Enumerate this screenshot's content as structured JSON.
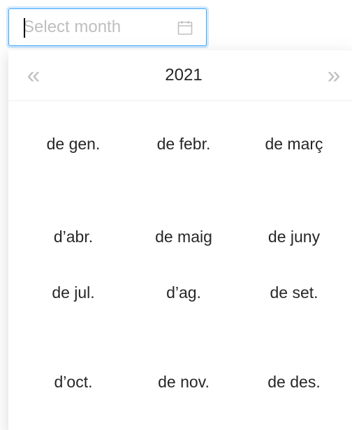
{
  "input": {
    "placeholder": "Select month",
    "value": ""
  },
  "icons": {
    "calendar": "calendar-icon",
    "prev": "double-chevron-left-icon",
    "next": "double-chevron-right-icon"
  },
  "header": {
    "prev_label": "«",
    "year": "2021",
    "next_label": "»"
  },
  "months": [
    "de gen.",
    "de febr.",
    "de març",
    "d’abr.",
    "de maig",
    "de juny",
    "de jul.",
    "d’ag.",
    "de set.",
    "d’oct.",
    "de nov.",
    "de des."
  ],
  "colors": {
    "accent": "#40a9ff",
    "placeholder": "#bfbfbf",
    "nav": "#bfbfbf"
  }
}
